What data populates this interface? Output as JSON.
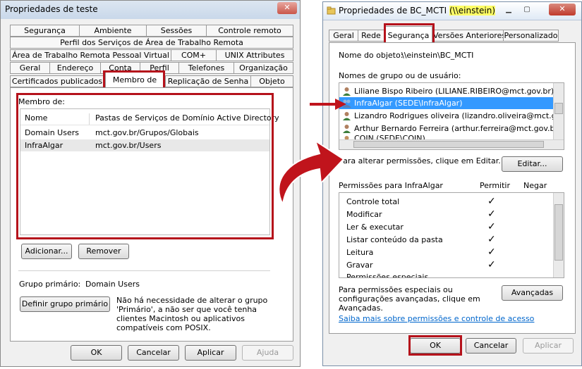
{
  "left": {
    "title": "Propriedades de teste",
    "close_glyph": "✕",
    "tabs_row1": [
      "Segurança",
      "Ambiente",
      "Sessões",
      "Controle remoto"
    ],
    "tabs_row2": [
      "Perfil dos Serviços de Área de Trabalho Remota"
    ],
    "tabs_row3": [
      "Área de Trabalho Remota Pessoal Virtual",
      "COM+",
      "UNIX Attributes"
    ],
    "tabs_row4": [
      "Geral",
      "Endereço",
      "Conta",
      "Perfil",
      "Telefones",
      "Organização"
    ],
    "tabs_row5": [
      "Certificados publicados",
      "Membro de",
      "Replicação de Senha",
      "Objeto"
    ],
    "member_of_label": "Membro de:",
    "columns": [
      "Nome",
      "Pastas de Serviços de Domínio Active Directory"
    ],
    "rows": [
      {
        "name": "Domain Users",
        "folder": "mct.gov.br/Grupos/Globais"
      },
      {
        "name": "InfraAlgar",
        "folder": "mct.gov.br/Users"
      }
    ],
    "add_button": "Adicionar...",
    "remove_button": "Remover",
    "primary_group_label": "Grupo primário:",
    "primary_group_value": "Domain Users",
    "set_primary_button": "Definir grupo primário",
    "primary_note": "Não há necessidade de alterar o grupo 'Primário', a não ser que você tenha clientes Macintosh ou aplicativos compatíveis com POSIX.",
    "ok": "OK",
    "cancel": "Cancelar",
    "apply": "Aplicar",
    "help": "Ajuda"
  },
  "right": {
    "title_main": "Propriedades de BC_MCTI ",
    "title_host": "(\\\\einstein)",
    "tabs": [
      "Geral",
      "Rede",
      "Segurança",
      "Versões Anteriores",
      "Personalizado"
    ],
    "object_name_label": "Nome do objeto:",
    "object_name_value": "\\\\einstein\\BC_MCTI",
    "group_users_label": "Nomes de grupo ou de usuário:",
    "users": [
      "Liliane Bispo Ribeiro (LILIANE.RIBEIRO@mct.gov.br)",
      "InfraAlgar (SEDE\\InfraAlgar)",
      "Lizandro Rodrigues oliveira (lizandro.oliveira@mct.gov.br)",
      "Arthur Bernardo Ferreira (arthur.ferreira@mct.gov.br)",
      "COIN (SEDE\\COIN)"
    ],
    "change_perm_text": "Para alterar permissões, clique em Editar.",
    "edit_button": "Editar...",
    "perms_for": "Permissões para InfraAlgar",
    "allow_label": "Permitir",
    "deny_label": "Negar",
    "permissions": [
      {
        "name": "Controle total",
        "allow": "✓"
      },
      {
        "name": "Modificar",
        "allow": "✓"
      },
      {
        "name": "Ler & executar",
        "allow": "✓"
      },
      {
        "name": "Listar conteúdo da pasta",
        "allow": "✓"
      },
      {
        "name": "Leitura",
        "allow": "✓"
      },
      {
        "name": "Gravar",
        "allow": "✓"
      },
      {
        "name": "Permissões especiais",
        "allow": ""
      }
    ],
    "special_text": "Para permissões especiais ou configurações avançadas, clique em Avançadas.",
    "advanced_button": "Avançadas",
    "learn_link": "Saiba mais sobre permissões e controle de acesso",
    "ok": "OK",
    "cancel": "Cancelar",
    "apply": "Aplicar",
    "close_glyph": "✕"
  },
  "colors": {
    "highlight_red": "#b5121b",
    "selection_blue": "#3399ff",
    "link_blue": "#0066cc",
    "title_yellow": "#ffff66"
  }
}
